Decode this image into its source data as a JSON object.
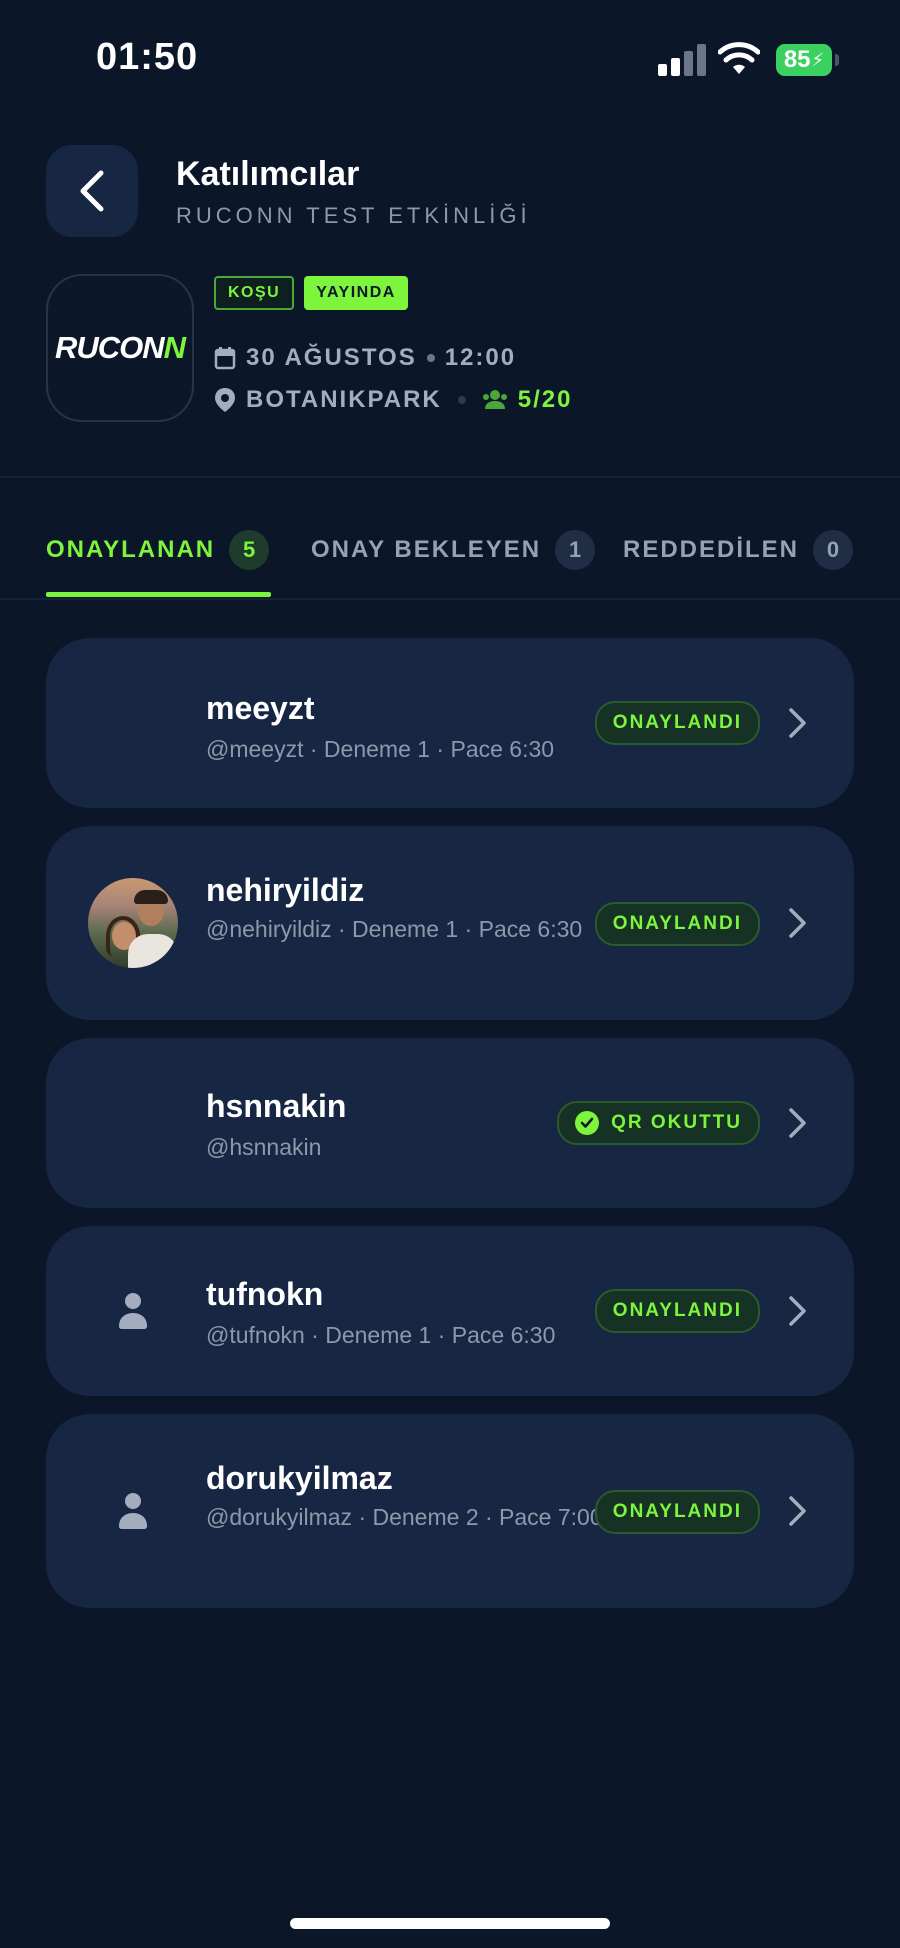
{
  "status_bar": {
    "time": "01:50",
    "battery": "85"
  },
  "header": {
    "title": "Katılımcılar",
    "subtitle": "RUCONN TEST ETKİNLİĞİ"
  },
  "event": {
    "logo_text_1": "RUCON",
    "logo_text_2": "N",
    "tags": [
      "KOŞU",
      "YAYINDA"
    ],
    "date": "30 AĞUSTOS",
    "time": "12:00",
    "location": "BOTANIKPARK",
    "capacity": "5/20"
  },
  "tabs": [
    {
      "label": "ONAYLANAN",
      "count": "5"
    },
    {
      "label": "ONAY BEKLEYEN",
      "count": "1"
    },
    {
      "label": "REDDEDİLEN",
      "count": "0"
    }
  ],
  "participants": [
    {
      "name": "meeyzt",
      "detail": "@meeyzt · Deneme 1 · Pace 6:30",
      "status": "ONAYLANDI",
      "avatar": "none"
    },
    {
      "name": "nehiryildiz",
      "detail": "@nehiryildiz · Deneme 1 · Pace 6:30",
      "status": "ONAYLANDI",
      "avatar": "photo"
    },
    {
      "name": "hsnnakin",
      "detail": "@hsnnakin",
      "status": "QR OKUTTU",
      "avatar": "none"
    },
    {
      "name": "tufnokn",
      "detail": "@tufnokn · Deneme 1 · Pace 6:30",
      "status": "ONAYLANDI",
      "avatar": "person-icon"
    },
    {
      "name": "dorukyilmaz",
      "detail": "@dorukyilmaz · Deneme 2 · Pace 7:00",
      "status": "ONAYLANDI",
      "avatar": "person-icon"
    }
  ],
  "colors": {
    "background": "#0b1629",
    "card": "#172743",
    "accent": "#7cf53c",
    "muted": "#8d98ab"
  }
}
